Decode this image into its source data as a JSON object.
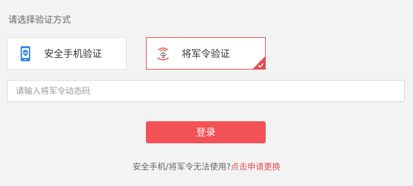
{
  "heading": "请选择验证方式",
  "methods": [
    {
      "label": "安全手机验证",
      "icon": "mobile-shield-icon",
      "selected": false
    },
    {
      "label": "将军令验证",
      "icon": "general-token-icon",
      "selected": true
    }
  ],
  "code_input": {
    "value": "",
    "placeholder": "请输入将军令动态码"
  },
  "login_button": "登录",
  "help": {
    "text": "安全手机/将军令无法使用?",
    "link": "点击申请更换"
  },
  "colors": {
    "accent": "#e0504f",
    "button": "#f25156",
    "phone_icon": "#3a8be0",
    "background": "#f3f3f3"
  }
}
